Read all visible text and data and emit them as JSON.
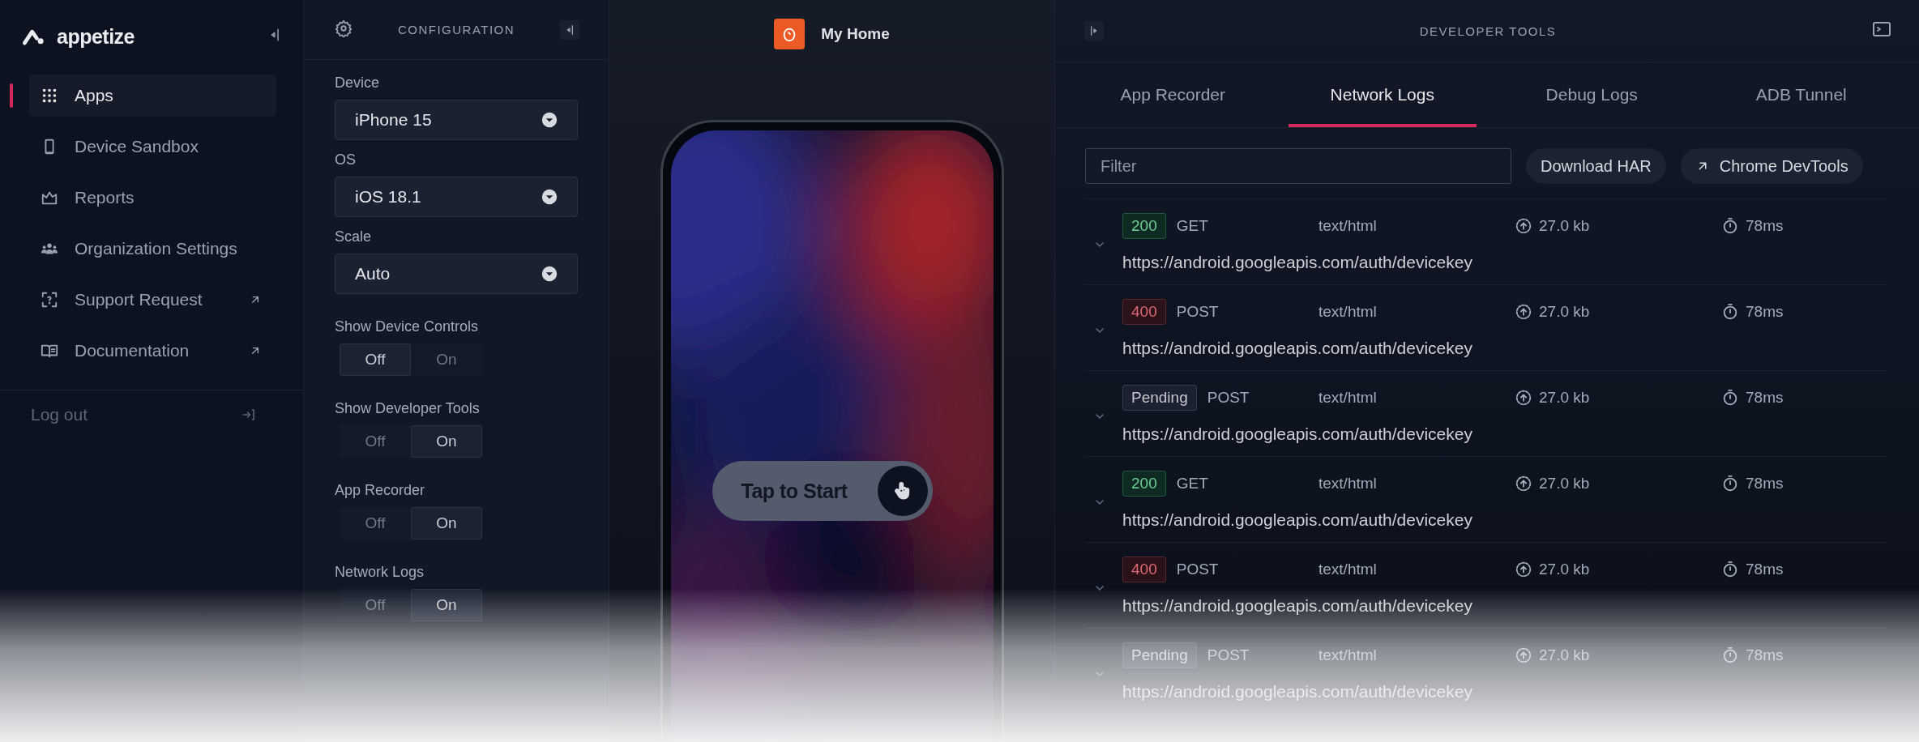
{
  "sidebar": {
    "logo": "appetize",
    "items": [
      {
        "label": "Apps",
        "selected": true,
        "external": false
      },
      {
        "label": "Device Sandbox",
        "selected": false,
        "external": false
      },
      {
        "label": "Reports",
        "selected": false,
        "external": false
      },
      {
        "label": "Organization Settings",
        "selected": false,
        "external": false
      },
      {
        "label": "Support Request",
        "selected": false,
        "external": true
      },
      {
        "label": "Documentation",
        "selected": false,
        "external": true
      }
    ],
    "logout": "Log out"
  },
  "configuration": {
    "title": "CONFIGURATION",
    "selects": [
      {
        "label": "Device",
        "value": "iPhone 15"
      },
      {
        "label": "OS",
        "value": "iOS 18.1"
      },
      {
        "label": "Scale",
        "value": "Auto"
      }
    ],
    "toggles": [
      {
        "label": "Show Device Controls",
        "options": [
          {
            "label": "Off",
            "selected": true
          },
          {
            "label": "On",
            "selected": false
          }
        ]
      },
      {
        "label": "Show Developer Tools",
        "options": [
          {
            "label": "Off",
            "selected": false
          },
          {
            "label": "On",
            "selected": true
          }
        ]
      },
      {
        "label": "App Recorder",
        "options": [
          {
            "label": "Off",
            "selected": false
          },
          {
            "label": "On",
            "selected": true
          }
        ]
      },
      {
        "label": "Network Logs",
        "options": [
          {
            "label": "Off",
            "selected": false
          },
          {
            "label": "On",
            "selected": true
          }
        ]
      }
    ]
  },
  "stage": {
    "app_name": "My Home",
    "button": "Tap to Start"
  },
  "developer_tools": {
    "title": "DEVELOPER TOOLS",
    "tabs": [
      {
        "label": "App Recorder",
        "selected": false
      },
      {
        "label": "Network Logs",
        "selected": true
      },
      {
        "label": "Debug Logs",
        "selected": false
      },
      {
        "label": "ADB Tunnel",
        "selected": false
      }
    ],
    "filter": {
      "placeholder": "Filter"
    },
    "buttons": [
      {
        "label": "Download HAR",
        "kind": "plain"
      },
      {
        "label": "Chrome DevTools",
        "kind": "external"
      }
    ],
    "requests": [
      {
        "status": "200",
        "kind": "success",
        "method": "GET",
        "type": "text/html",
        "size": "27.0 kb",
        "time": "78ms",
        "url": "https://android.googleapis.com/auth/devicekey"
      },
      {
        "status": "400",
        "kind": "error",
        "method": "POST",
        "type": "text/html",
        "size": "27.0 kb",
        "time": "78ms",
        "url": "https://android.googleapis.com/auth/devicekey"
      },
      {
        "status": "Pending",
        "kind": "pending",
        "method": "POST",
        "type": "text/html",
        "size": "27.0 kb",
        "time": "78ms",
        "url": "https://android.googleapis.com/auth/devicekey"
      },
      {
        "status": "200",
        "kind": "success",
        "method": "GET",
        "type": "text/html",
        "size": "27.0 kb",
        "time": "78ms",
        "url": "https://android.googleapis.com/auth/devicekey"
      },
      {
        "status": "400",
        "kind": "error",
        "method": "POST",
        "type": "text/html",
        "size": "27.0 kb",
        "time": "78ms",
        "url": "https://android.googleapis.com/auth/devicekey"
      },
      {
        "status": "Pending",
        "kind": "pending",
        "method": "POST",
        "type": "text/html",
        "size": "27.0 kb",
        "time": "78ms",
        "url": "https://android.googleapis.com/auth/devicekey"
      }
    ]
  }
}
